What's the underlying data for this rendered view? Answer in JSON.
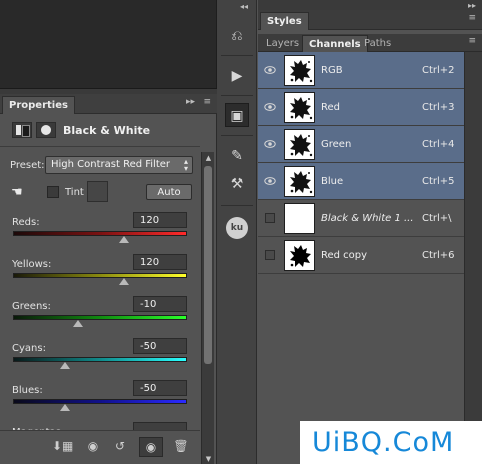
{
  "properties": {
    "tab_label": "Properties",
    "adjustment_title": "Black & White",
    "preset_label": "Preset:",
    "preset_value": "High Contrast Red Filter",
    "tint_label": "Tint",
    "auto_label": "Auto",
    "sliders": [
      {
        "label": "Reds:",
        "value": "120",
        "pos": 0.64,
        "gradient": "linear-gradient(to right, #1c0a0a, #7a1212, #ff2a2a)"
      },
      {
        "label": "Yellows:",
        "value": "120",
        "pos": 0.64,
        "gradient": "linear-gradient(to right, #1a1a0a, #8a8a10, #ffff2a)"
      },
      {
        "label": "Greens:",
        "value": "-10",
        "pos": 0.375,
        "gradient": "linear-gradient(to right, #0a1a0a, #108a10, #2aff2a)"
      },
      {
        "label": "Cyans:",
        "value": "-50",
        "pos": 0.3,
        "gradient": "linear-gradient(to right, #0a1a1a, #108a8a, #2affff)"
      },
      {
        "label": "Blues:",
        "value": "-50",
        "pos": 0.3,
        "gradient": "linear-gradient(to right, #0a0a1a, #10108a, #2a2aff)"
      },
      {
        "label": "Magentas:",
        "value": "",
        "pos": 0.5,
        "gradient": "linear-gradient(to right, #1a0a1a, #8a108a, #ff2aff)"
      }
    ]
  },
  "panels": {
    "styles_label": "Styles",
    "tabs": [
      "Layers",
      "Channels",
      "Paths"
    ],
    "active_tab": "Channels",
    "channels": [
      {
        "name": "RGB",
        "shortcut": "Ctrl+2",
        "visible": true,
        "selected": true,
        "thumb": "splat",
        "italic": false
      },
      {
        "name": "Red",
        "shortcut": "Ctrl+3",
        "visible": true,
        "selected": true,
        "thumb": "splat",
        "italic": false
      },
      {
        "name": "Green",
        "shortcut": "Ctrl+4",
        "visible": true,
        "selected": true,
        "thumb": "splat",
        "italic": false
      },
      {
        "name": "Blue",
        "shortcut": "Ctrl+5",
        "visible": true,
        "selected": true,
        "thumb": "splat",
        "italic": false
      },
      {
        "name": "Black & White 1 ...",
        "shortcut": "Ctrl+\\",
        "visible": false,
        "selected": false,
        "thumb": "white",
        "italic": true
      },
      {
        "name": "Red copy",
        "shortcut": "Ctrl+6",
        "visible": false,
        "selected": false,
        "thumb": "solid",
        "italic": false
      }
    ]
  },
  "toolbar": {
    "ku_label": "ku"
  },
  "watermark": {
    "text": "UiBQ.CoM"
  },
  "colors": {
    "selection": "#5a6d8a",
    "watermark": "#1688d8"
  }
}
